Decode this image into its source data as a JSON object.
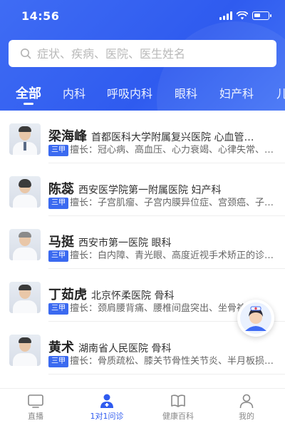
{
  "status_bar": {
    "time": "14:56"
  },
  "search": {
    "placeholder": "症状、疾病、医院、医生姓名"
  },
  "tabs": [
    {
      "label": "全部"
    },
    {
      "label": "内科"
    },
    {
      "label": "呼吸内科"
    },
    {
      "label": "眼科"
    },
    {
      "label": "妇产科"
    },
    {
      "label": "儿"
    }
  ],
  "doctors": [
    {
      "name": "梁海峰",
      "hospital": "首都医科大学附属复兴医院 心血管…",
      "badge": "三甲",
      "skill": "擅长：冠心病、高血压、心力衰竭、心律失常、…"
    },
    {
      "name": "陈蕊",
      "hospital": "西安医学院第一附属医院 妇产科",
      "badge": "三甲",
      "skill": "擅长：子宫肌瘤、子宫内膜异位症、宫颈癌、子…"
    },
    {
      "name": "马挺",
      "hospital": "西安市第一医院 眼科",
      "badge": "三甲",
      "skill": "擅长：白内障、青光眼、高度近视手术矫正的诊…"
    },
    {
      "name": "丁茹虎",
      "hospital": "北京怀柔医院 骨科",
      "badge": "三甲",
      "skill": "擅长：颈肩腰背痛、腰椎间盘突出、坐骨神经…"
    },
    {
      "name": "黄术",
      "hospital": "湖南省人民医院 骨科",
      "badge": "三甲",
      "skill": "擅长：骨质疏松、膝关节骨性关节炎、半月板损…"
    }
  ],
  "bottom_nav": [
    {
      "label": "直播",
      "icon": "tv-icon"
    },
    {
      "label": "1对1问诊",
      "icon": "doctor-icon"
    },
    {
      "label": "健康百科",
      "icon": "book-icon"
    },
    {
      "label": "我的",
      "icon": "user-icon"
    }
  ],
  "colors": {
    "brand": "#2f5bef",
    "badge": "#3b6af0"
  }
}
